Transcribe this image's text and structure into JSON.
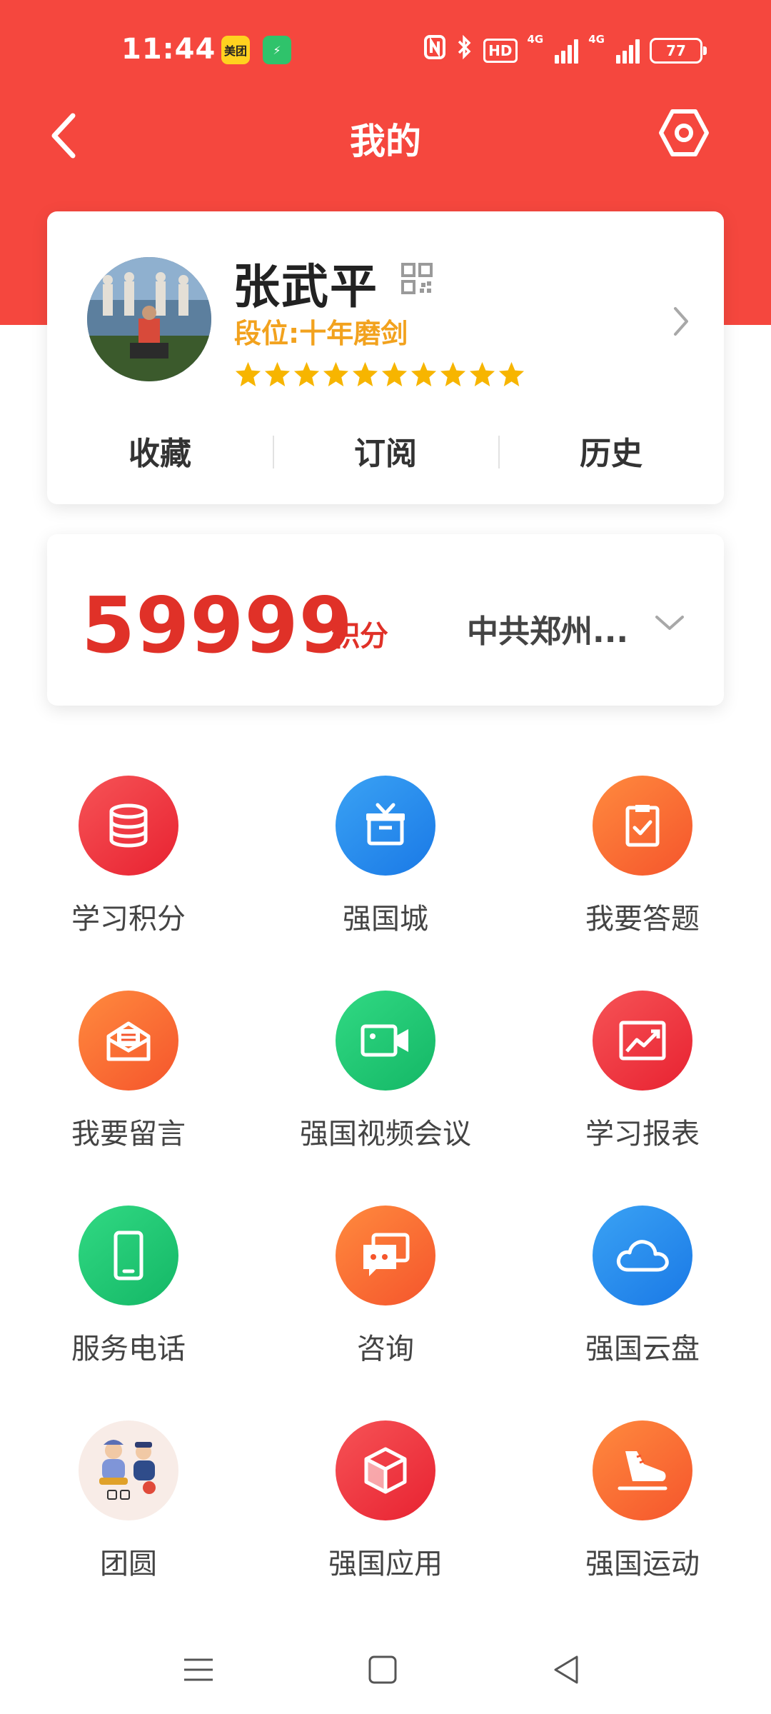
{
  "status_bar": {
    "time": "11:44",
    "app_badges": [
      "美团",
      "⚡"
    ],
    "network": "4G",
    "hd": "HD",
    "battery": "77"
  },
  "nav": {
    "title": "我的"
  },
  "profile": {
    "name": "张武平",
    "rank": "段位:十年磨剑",
    "stars": 10,
    "tabs": [
      "收藏",
      "订阅",
      "历史"
    ]
  },
  "points": {
    "value": "59999",
    "unit": "积分",
    "org": "中共郑州..."
  },
  "grid": [
    {
      "label": "学习积分",
      "icon": "database-icon"
    },
    {
      "label": "强国城",
      "icon": "gift-icon"
    },
    {
      "label": "我要答题",
      "icon": "clipboard-check-icon"
    },
    {
      "label": "我要留言",
      "icon": "mail-icon"
    },
    {
      "label": "强国视频会议",
      "icon": "video-camera-icon"
    },
    {
      "label": "学习报表",
      "icon": "chart-trend-icon"
    },
    {
      "label": "服务电话",
      "icon": "phone-icon"
    },
    {
      "label": "咨询",
      "icon": "chat-icon"
    },
    {
      "label": "强国云盘",
      "icon": "cloud-icon"
    },
    {
      "label": "团圆",
      "icon": "family-illustration-icon"
    },
    {
      "label": "强国应用",
      "icon": "cube-icon"
    },
    {
      "label": "强国运动",
      "icon": "sneaker-icon"
    }
  ],
  "colors": {
    "header_red": "#f5473e",
    "points_red": "#e03128",
    "rank_gold": "#f2a21e",
    "star_gold": "#f7b500"
  }
}
